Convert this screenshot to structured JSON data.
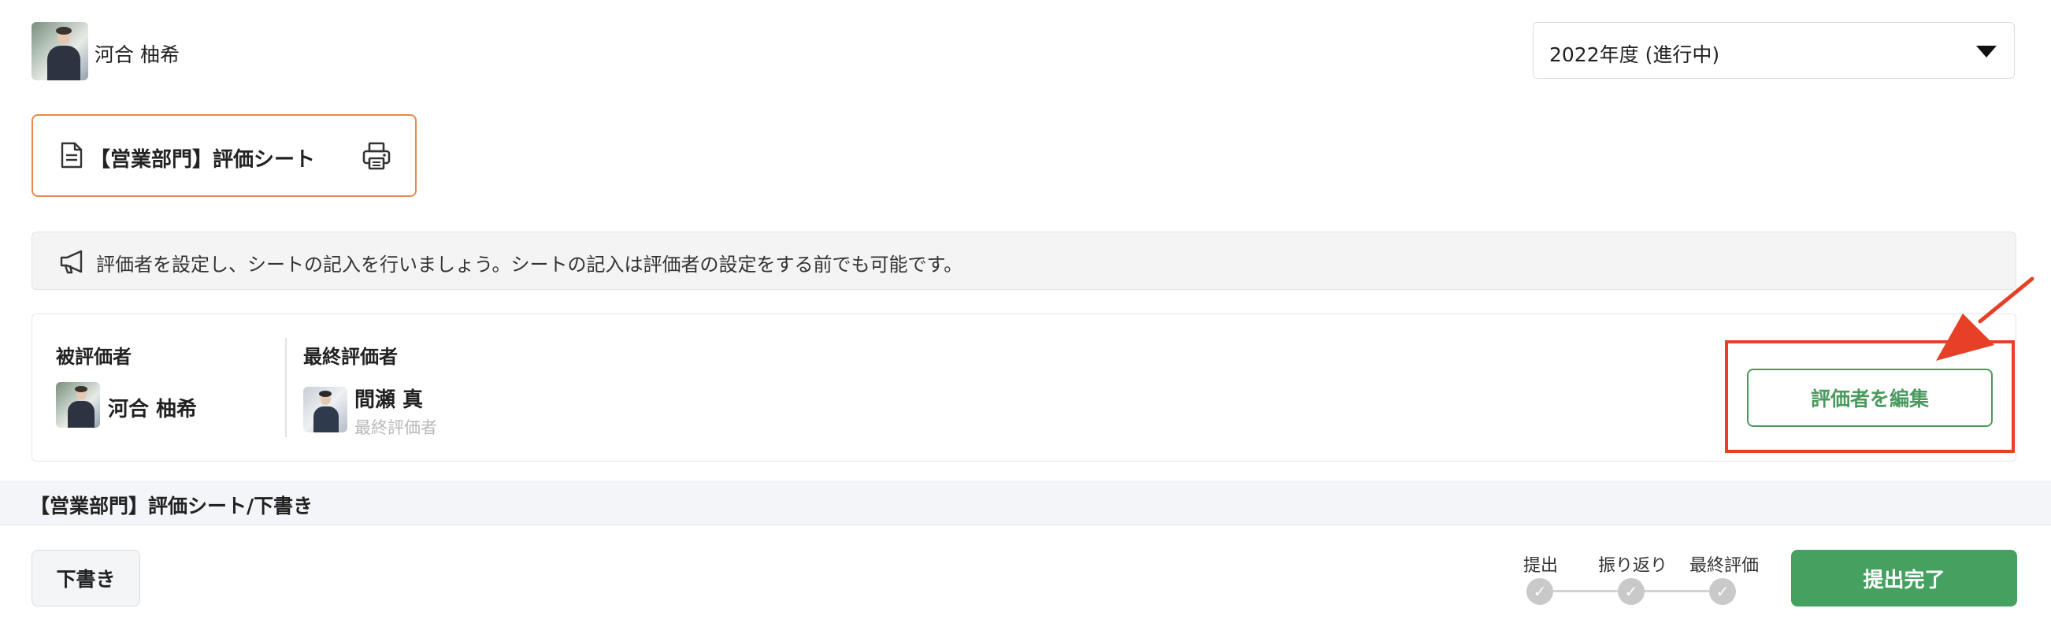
{
  "header": {
    "user_name": "河合 柚希",
    "year_select": {
      "value": "2022年度 (進行中)"
    }
  },
  "sheet_card": {
    "title": "【営業部門】評価シート",
    "icons": {
      "document": "document-icon",
      "print": "print-icon"
    }
  },
  "notice": {
    "icon": "megaphone-icon",
    "text": "評価者を設定し、シートの記入を行いましょう。シートの記入は評価者の設定をする前でも可能です。"
  },
  "evaluators": {
    "evaluatee_label": "被評価者",
    "evaluatee_name": "河合 柚希",
    "final_label": "最終評価者",
    "final_name": "間瀬 真",
    "final_role": "最終評価者",
    "edit_button_label": "評価者を編集"
  },
  "section": {
    "title": "【営業部門】評価シート/下書き"
  },
  "footer": {
    "draft_label": "下書き",
    "steps": [
      {
        "label": "提出",
        "done": true
      },
      {
        "label": "振り返り",
        "done": true
      },
      {
        "label": "最終評価",
        "done": true
      }
    ],
    "submit_label": "提出完了"
  },
  "colors": {
    "accent_green": "#45a160",
    "card_border_orange": "#e8874f",
    "annotation_red": "#e64027"
  }
}
